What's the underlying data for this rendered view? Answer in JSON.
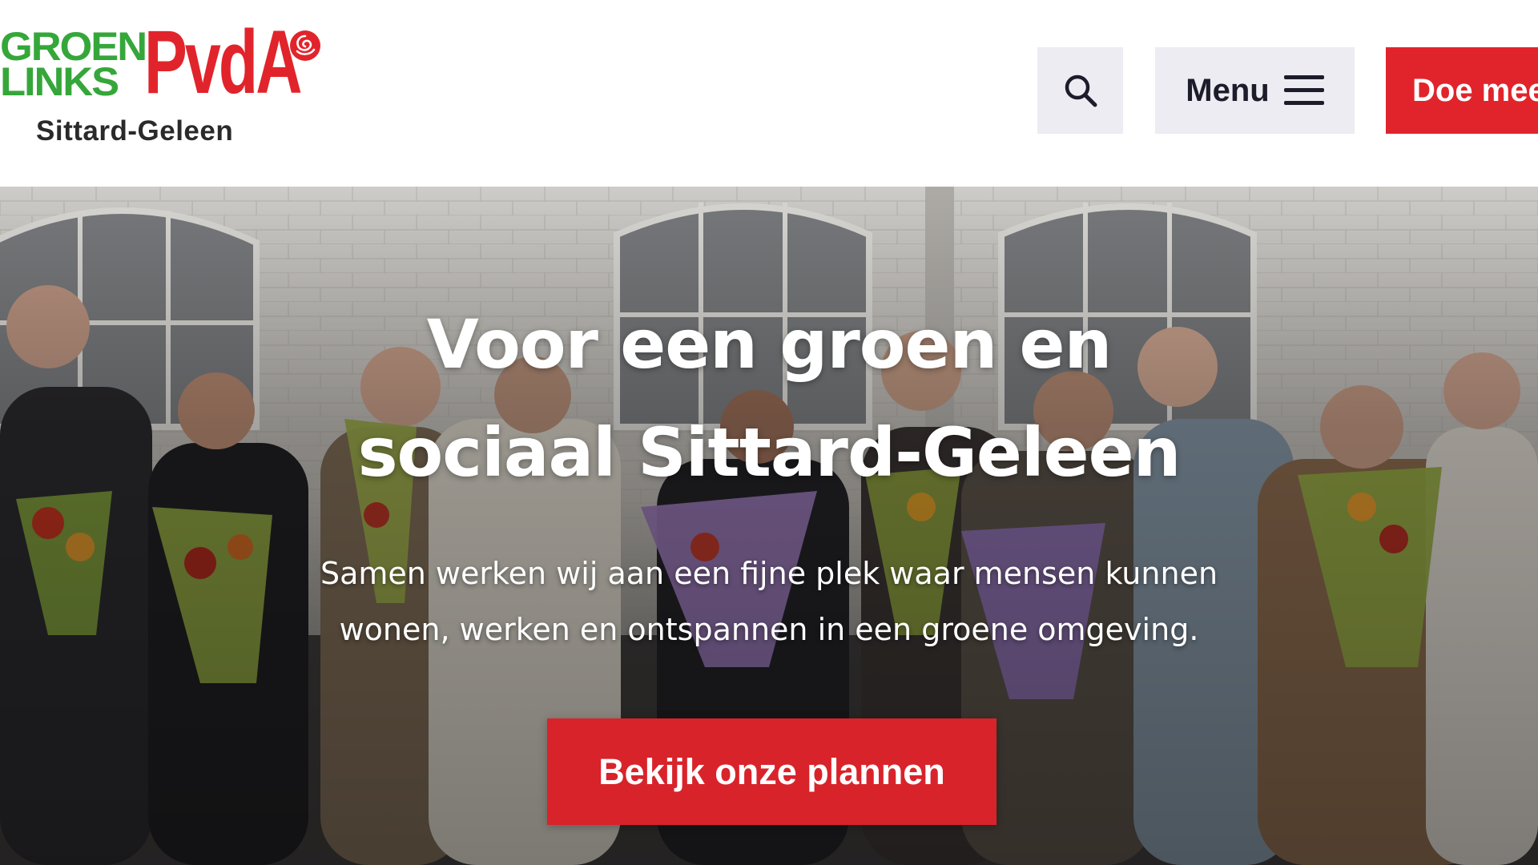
{
  "header": {
    "logo": {
      "groen": "GROEN",
      "links": "LINKS",
      "pvda": "PvdA",
      "city": "Sittard-Geleen"
    },
    "search": {
      "icon": "search-icon"
    },
    "menu": {
      "label": "Menu",
      "icon": "hamburger-icon"
    },
    "cta": {
      "label": "Doe mee"
    }
  },
  "hero": {
    "title_line1": "Voor een groen en",
    "title_line2": "sociaal Sittard-Geleen",
    "subtitle_line1": "Samen werken wij aan een fijne plek waar mensen kunnen",
    "subtitle_line2": "wonen, werken en ontspannen in een groene omgeving.",
    "button_label": "Bekijk onze plannen"
  },
  "colors": {
    "brand_red": "#e1242b",
    "brand_green": "#35a73a",
    "button_grey": "#ececf2"
  }
}
